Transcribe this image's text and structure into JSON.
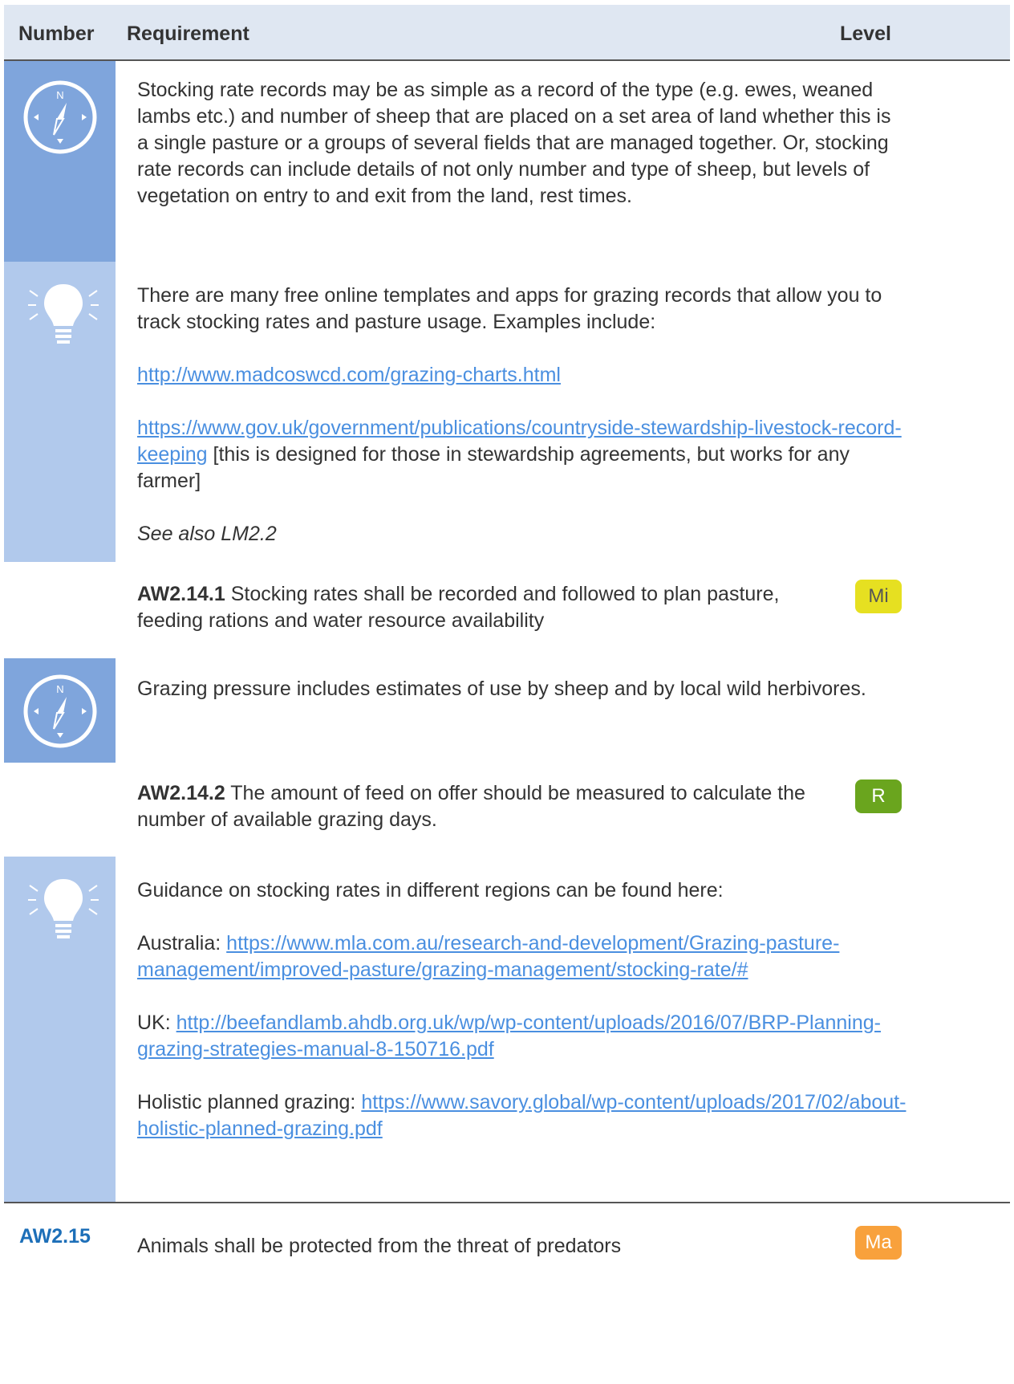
{
  "header": {
    "number": "Number",
    "requirement": "Requirement",
    "level": "Level"
  },
  "colors": {
    "compass_bg": "#7fa5dc",
    "bulb_bg": "#b1c9ec",
    "mi": "#e6e021",
    "r": "#6aa51e",
    "ma": "#f8a13c"
  },
  "block1": {
    "icon": "compass-icon",
    "text": "Stocking rate records may be as simple as a record of the type (e.g. ewes, weaned lambs etc.) and number of sheep that are placed on a set area of land whether this is a single pasture or a groups of several fields that are managed together. Or, stocking rate records can include details of not only number and type of sheep, but levels of vegetation on entry to and exit from the land, rest times."
  },
  "block2": {
    "icon": "lightbulb-icon",
    "intro": "There are many free online templates and apps for grazing records that allow you to track stocking rates and pasture usage. Examples include:",
    "link1": "http://www.madcoswcd.com/grazing-charts.html",
    "link2": "https://www.gov.uk/government/publications/countryside-stewardship-livestock-record-keeping",
    "link2_note": " [this is designed for those in stewardship agreements, but works for any farmer]",
    "see_also": "See also LM2.2"
  },
  "req1": {
    "code": "AW2.14.1",
    "text": "  Stocking rates shall be recorded and followed to plan pasture, feeding rations and water resource availability",
    "level": "Mi"
  },
  "block3": {
    "icon": "compass-icon",
    "text": "Grazing pressure includes estimates of use by sheep and by local wild herbivores."
  },
  "req2": {
    "code": "AW2.14.2",
    "text": " The amount of feed on offer should be measured to calculate the number of available grazing days.",
    "level": "R"
  },
  "block4": {
    "icon": "lightbulb-icon",
    "intro": "Guidance on stocking rates in different regions can be found here:",
    "aus_label": "Australia: ",
    "aus_link": "https://www.mla.com.au/research-and-development/Grazing-pasture-management/improved-pasture/grazing-management/stocking-rate/#",
    "uk_label": "UK: ",
    "uk_link": "http://beefandlamb.ahdb.org.uk/wp/wp-content/uploads/2016/07/BRP-Planning-grazing-strategies-manual-8-150716.pdf",
    "hol_label": "Holistic planned grazing: ",
    "hol_link": "https://www.savory.global/wp-content/uploads/2017/02/about-holistic-planned-grazing.pdf"
  },
  "req3": {
    "number": "AW2.15",
    "text": "Animals shall be protected from the threat of predators",
    "level": "Ma"
  }
}
